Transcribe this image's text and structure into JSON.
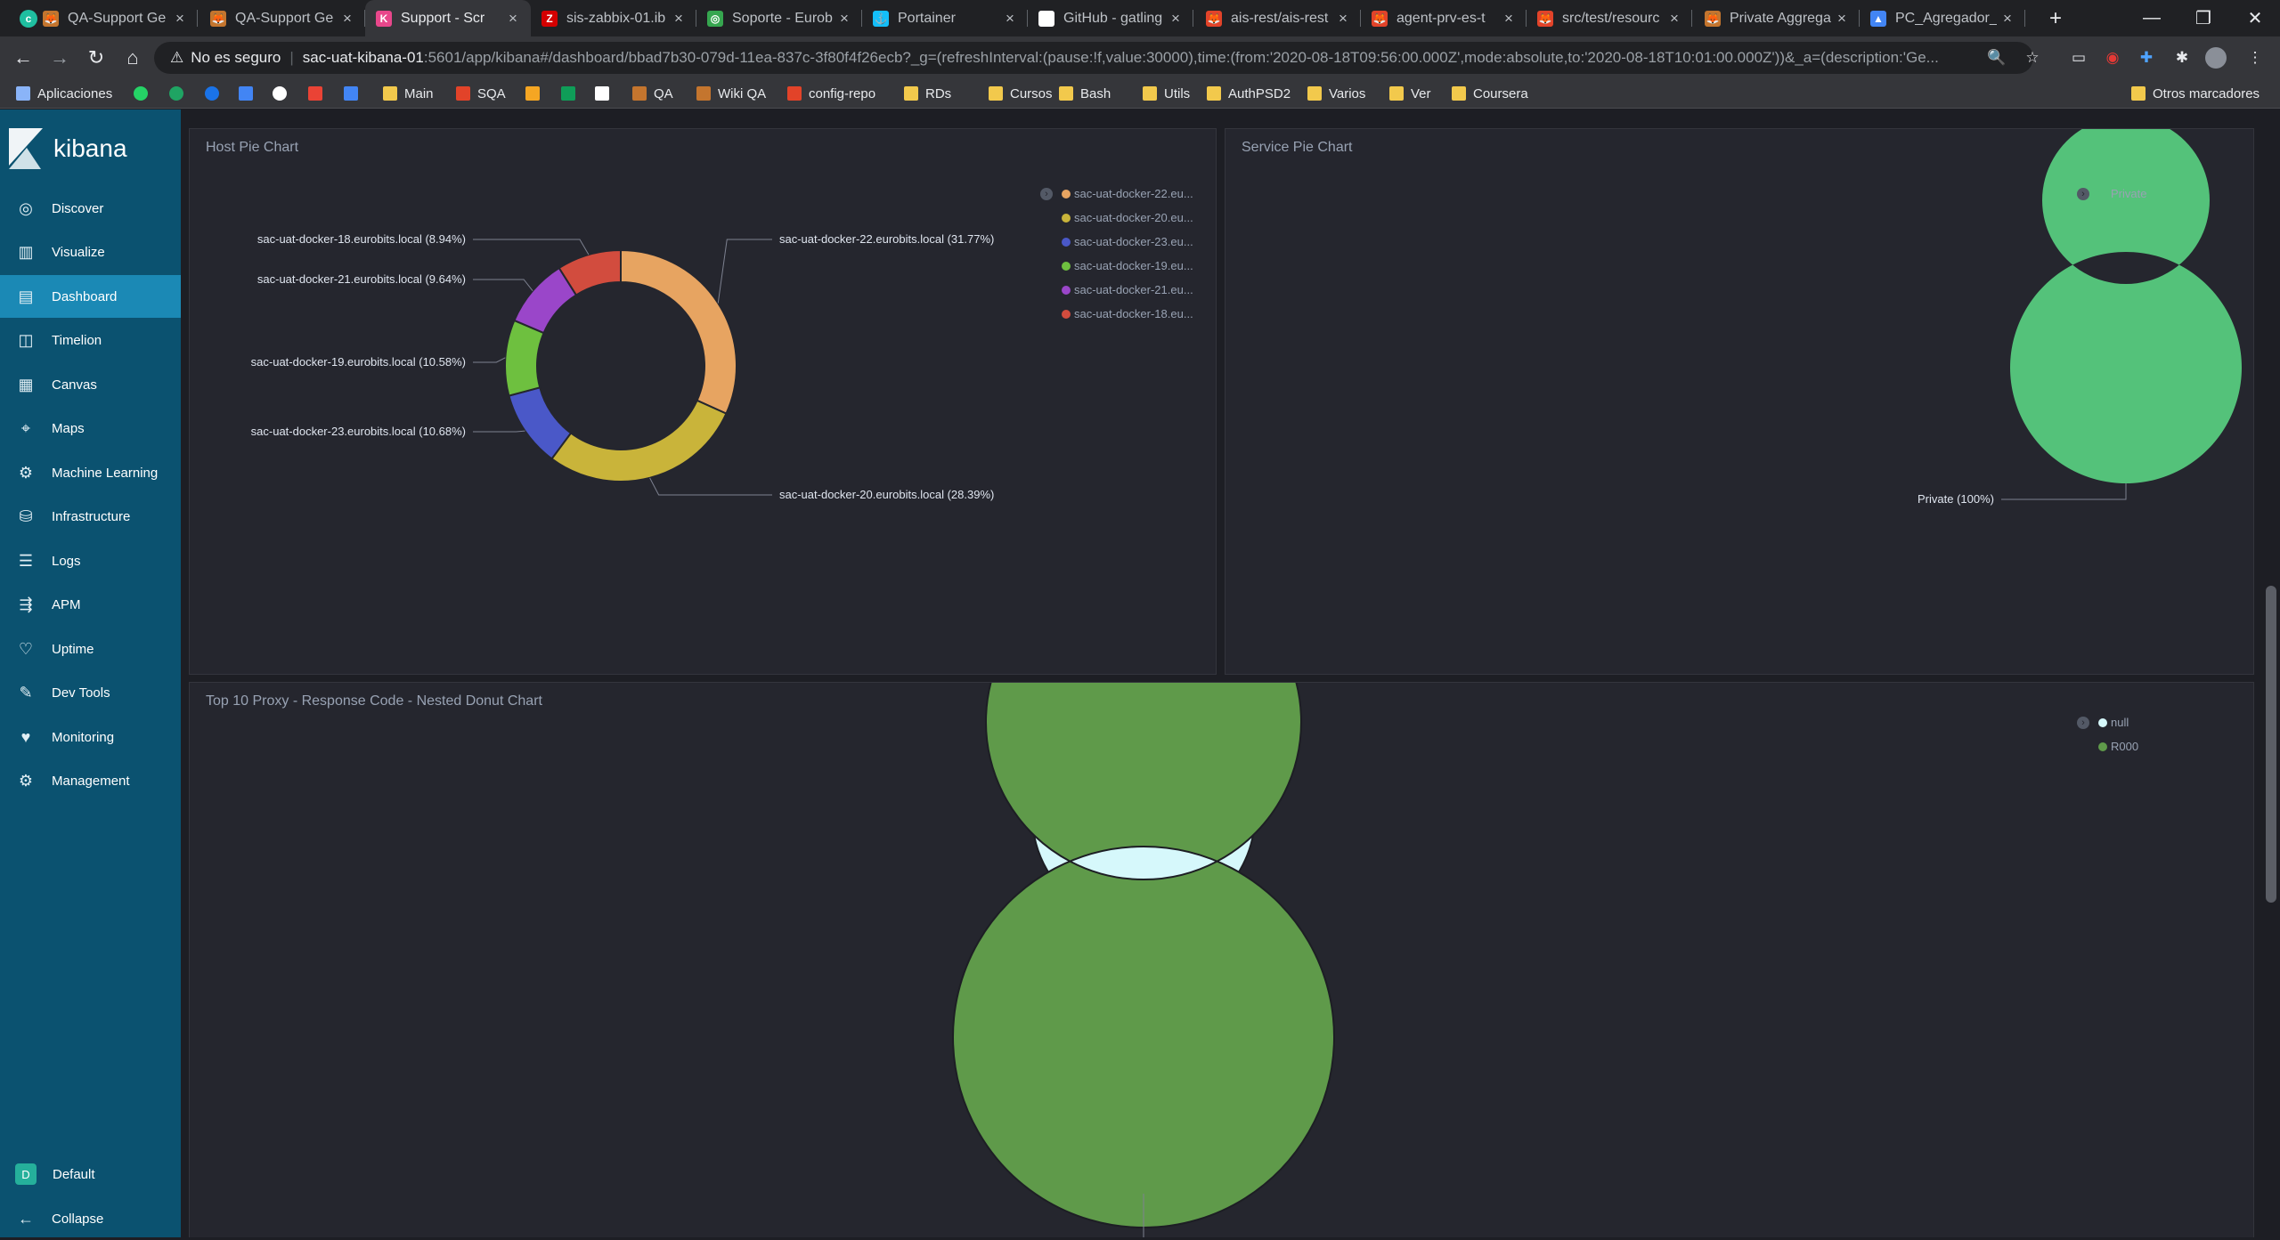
{
  "browser": {
    "tabs": [
      {
        "label": "QA-Support Ge",
        "fav_color": "#c4752e",
        "fav_glyph": "🦊"
      },
      {
        "label": "QA-Support Ge",
        "fav_color": "#c4752e",
        "fav_glyph": "🦊"
      },
      {
        "label": "Support - Scr",
        "fav_color": "#e8478b",
        "fav_glyph": "K",
        "active": true
      },
      {
        "label": "sis-zabbix-01.ib",
        "fav_color": "#d40000",
        "fav_glyph": "Z"
      },
      {
        "label": "Soporte - Eurob",
        "fav_color": "#36a64f",
        "fav_glyph": "◎"
      },
      {
        "label": "Portainer",
        "fav_color": "#13bef9",
        "fav_glyph": "⚓"
      },
      {
        "label": "GitHub - gatling",
        "fav_color": "#ffffff",
        "fav_glyph": "●"
      },
      {
        "label": "ais-rest/ais-rest",
        "fav_color": "#e24329",
        "fav_glyph": "🦊"
      },
      {
        "label": "agent-prv-es-t",
        "fav_color": "#e24329",
        "fav_glyph": "🦊"
      },
      {
        "label": "src/test/resourc",
        "fav_color": "#e24329",
        "fav_glyph": "🦊"
      },
      {
        "label": "Private Aggrega",
        "fav_color": "#c4752e",
        "fav_glyph": "🦊"
      },
      {
        "label": "PC_Agregador_",
        "fav_color": "#4285f4",
        "fav_glyph": "▲"
      }
    ],
    "new_tab": "+",
    "window": {
      "minimize": "—",
      "restore": "❐",
      "close": "✕"
    },
    "omnibox": {
      "security": "No es seguro",
      "host": "sac-uat-kibana-01",
      "path": ":5601/app/kibana#/dashboard/bbad7b30-079d-11ea-837c-3f80f4f26ecb?_g=(refreshInterval:(pause:!f,value:30000),time:(from:'2020-08-18T09:56:00.000Z',mode:absolute,to:'2020-08-18T10:01:00.000Z'))&_a=(description:'Ge..."
    },
    "bookmarks": [
      {
        "label": "Aplicaciones",
        "icon": "apps-grid-icon"
      },
      {
        "label": "",
        "icon": "whatsapp-icon"
      },
      {
        "label": "",
        "icon": "hangouts-icon"
      },
      {
        "label": "",
        "icon": "globe-icon"
      },
      {
        "label": "",
        "icon": "translate-icon"
      },
      {
        "label": "",
        "icon": "google-icon"
      },
      {
        "label": "",
        "icon": "gmail-icon"
      },
      {
        "label": "",
        "icon": "calendar-icon"
      },
      {
        "label": "Main",
        "icon": "folder-icon"
      },
      {
        "label": "SQA",
        "icon": "gitlab-icon"
      },
      {
        "label": "",
        "icon": "hand-icon"
      },
      {
        "label": "",
        "icon": "sheets-icon"
      },
      {
        "label": "",
        "icon": "trello-icon"
      },
      {
        "label": "QA",
        "icon": "fox-icon"
      },
      {
        "label": "Wiki QA",
        "icon": "fox-icon"
      },
      {
        "label": "config-repo",
        "icon": "gitlab-icon"
      },
      {
        "label": "RDs",
        "icon": "folder-icon"
      },
      {
        "label": "Cursos",
        "icon": "folder-icon"
      },
      {
        "label": "Bash",
        "icon": "folder-icon"
      },
      {
        "label": "Utils",
        "icon": "folder-icon"
      },
      {
        "label": "AuthPSD2",
        "icon": "folder-icon"
      },
      {
        "label": "Varios",
        "icon": "folder-icon"
      },
      {
        "label": "Ver",
        "icon": "folder-icon"
      },
      {
        "label": "Coursera",
        "icon": "folder-icon"
      }
    ],
    "other_bookmarks": "Otros marcadores"
  },
  "kibana": {
    "logo_text": "kibana",
    "nav": [
      {
        "label": "Discover",
        "icon": "compass-icon"
      },
      {
        "label": "Visualize",
        "icon": "visualize-icon"
      },
      {
        "label": "Dashboard",
        "icon": "dashboard-icon",
        "active": true
      },
      {
        "label": "Timelion",
        "icon": "timelion-icon"
      },
      {
        "label": "Canvas",
        "icon": "canvas-icon"
      },
      {
        "label": "Maps",
        "icon": "maps-icon"
      },
      {
        "label": "Machine Learning",
        "icon": "machine-learning-icon"
      },
      {
        "label": "Infrastructure",
        "icon": "infrastructure-icon"
      },
      {
        "label": "Logs",
        "icon": "logs-icon"
      },
      {
        "label": "APM",
        "icon": "apm-icon"
      },
      {
        "label": "Uptime",
        "icon": "uptime-icon"
      },
      {
        "label": "Dev Tools",
        "icon": "dev-tools-icon"
      },
      {
        "label": "Monitoring",
        "icon": "monitoring-icon"
      },
      {
        "label": "Management",
        "icon": "gear-icon"
      }
    ],
    "space": {
      "badge": "D",
      "label": "Default"
    },
    "collapse": "Collapse"
  },
  "panels": {
    "host": {
      "title": "Host Pie Chart"
    },
    "service": {
      "title": "Service Pie Chart"
    },
    "proxy": {
      "title": "Top 10 Proxy - Response Code - Nested Donut Chart"
    }
  },
  "chart_data": [
    {
      "type": "pie",
      "title": "Host Pie Chart",
      "donut": true,
      "slices": [
        {
          "label": "sac-uat-docker-22.eurobits.local",
          "legend": "sac-uat-docker-22.eu...",
          "value": 31.77,
          "color": "#e7a461"
        },
        {
          "label": "sac-uat-docker-20.eurobits.local",
          "legend": "sac-uat-docker-20.eu...",
          "value": 28.39,
          "color": "#c9b43a"
        },
        {
          "label": "sac-uat-docker-23.eurobits.local",
          "legend": "sac-uat-docker-23.eu...",
          "value": 10.68,
          "color": "#4a58c8"
        },
        {
          "label": "sac-uat-docker-19.eurobits.local",
          "legend": "sac-uat-docker-19.eu...",
          "value": 10.58,
          "color": "#6ec03f"
        },
        {
          "label": "sac-uat-docker-21.eurobits.local",
          "legend": "sac-uat-docker-21.eu...",
          "value": 9.64,
          "color": "#9a46c9"
        },
        {
          "label": "sac-uat-docker-18.eurobits.local",
          "legend": "sac-uat-docker-18.eu...",
          "value": 8.94,
          "color": "#d24c3e"
        }
      ],
      "legend_position": "top-right"
    },
    {
      "type": "pie",
      "title": "Service Pie Chart",
      "donut": true,
      "slices": [
        {
          "label": "Private",
          "legend": "Private",
          "value": 100,
          "color": "#54c27a"
        }
      ],
      "legend_position": "top-right"
    },
    {
      "type": "pie",
      "title": "Top 10 Proxy - Response Code - Nested Donut Chart",
      "donut": true,
      "nested": true,
      "rings": [
        {
          "level": "inner",
          "slices": [
            {
              "label": "null",
              "legend": "null",
              "value": 100,
              "color": "#d6f8fb"
            }
          ]
        },
        {
          "level": "outer",
          "slices": [
            {
              "label": "R000",
              "legend": "R000",
              "value": 100,
              "color": "#5f9a4a"
            }
          ]
        }
      ],
      "legend_position": "top-right"
    }
  ]
}
